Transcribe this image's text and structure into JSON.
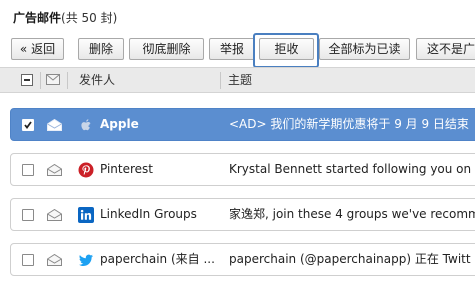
{
  "folder": {
    "name": "广告邮件",
    "count_text": "(共 50 封)"
  },
  "toolbar": {
    "back_label": "« 返回",
    "delete_label": "删除",
    "perm_delete_label": "彻底删除",
    "report_label": "举报",
    "reject_label": "拒收",
    "mark_all_read_label": "全部标为已读",
    "not_ad_label": "这不是广"
  },
  "columns": {
    "sender": "发件人",
    "subject": "主题"
  },
  "messages": [
    {
      "sender": "Apple",
      "subject": "<AD> 我们的新学期优惠将于 9 月 9 日结束",
      "selected": true,
      "icon": "apple-icon"
    },
    {
      "sender": "Pinterest",
      "subject": "Krystal Bennett started following you on",
      "selected": false,
      "icon": "pinterest-icon"
    },
    {
      "sender": "LinkedIn Groups",
      "subject": "家逸郑, join these 4 groups we've recomm",
      "selected": false,
      "icon": "linkedin-icon"
    },
    {
      "sender": "paperchain (来自 ...",
      "subject": "paperchain (@paperchainapp) 正在 Twitt",
      "selected": false,
      "icon": "twitter-icon"
    }
  ],
  "colors": {
    "selected_row": "#5b8ed0",
    "highlight_border": "#4a7fc0",
    "pinterest": "#cb2027",
    "linkedin": "#0a66c2",
    "twitter": "#1da1f2"
  }
}
